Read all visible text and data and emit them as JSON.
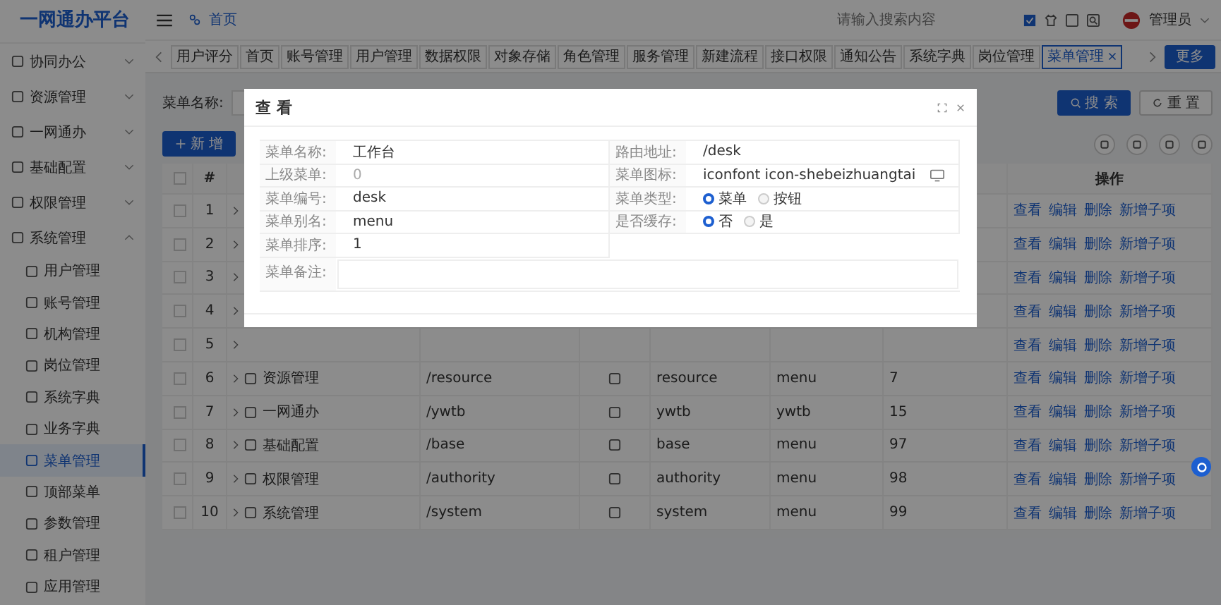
{
  "app": {
    "title": "一网通办平台"
  },
  "header": {
    "breadcrumb": "首页",
    "search": {
      "placeholder": "请输入搜索内容"
    },
    "user": "管理员"
  },
  "sidebar": {
    "items": [
      {
        "label": "协同办公",
        "expanded": false
      },
      {
        "label": "资源管理",
        "expanded": false
      },
      {
        "label": "一网通办",
        "expanded": false
      },
      {
        "label": "基础配置",
        "expanded": false
      },
      {
        "label": "权限管理",
        "expanded": false
      },
      {
        "label": "系统管理",
        "expanded": true,
        "children": [
          {
            "label": "用户管理",
            "selected": false
          },
          {
            "label": "账号管理",
            "selected": false
          },
          {
            "label": "机构管理",
            "selected": false
          },
          {
            "label": "岗位管理",
            "selected": false
          },
          {
            "label": "系统字典",
            "selected": false
          },
          {
            "label": "业务字典",
            "selected": false
          },
          {
            "label": "菜单管理",
            "selected": true
          },
          {
            "label": "顶部菜单",
            "selected": false
          },
          {
            "label": "参数管理",
            "selected": false
          },
          {
            "label": "租户管理",
            "selected": false
          },
          {
            "label": "应用管理",
            "selected": false
          }
        ]
      }
    ]
  },
  "tabs": [
    {
      "label": "用户评分",
      "selected": false,
      "closable": false
    },
    {
      "label": "首页",
      "selected": false,
      "closable": false
    },
    {
      "label": "账号管理",
      "selected": false,
      "closable": false
    },
    {
      "label": "用户管理",
      "selected": false,
      "closable": false
    },
    {
      "label": "数据权限",
      "selected": false,
      "closable": false
    },
    {
      "label": "对象存储",
      "selected": false,
      "closable": false
    },
    {
      "label": "角色管理",
      "selected": false,
      "closable": false
    },
    {
      "label": "服务管理",
      "selected": false,
      "closable": false
    },
    {
      "label": "新建流程",
      "selected": false,
      "closable": false
    },
    {
      "label": "接口权限",
      "selected": false,
      "closable": false
    },
    {
      "label": "通知公告",
      "selected": false,
      "closable": false
    },
    {
      "label": "系统字典",
      "selected": false,
      "closable": false
    },
    {
      "label": "岗位管理",
      "selected": false,
      "closable": false
    },
    {
      "label": "菜单管理",
      "selected": true,
      "closable": true
    }
  ],
  "more_button": "更多",
  "search_form": {
    "label": "菜单名称:",
    "search_button": "搜 索",
    "reset_button": "重 置"
  },
  "toolbar": {
    "add_button": "新 增"
  },
  "table": {
    "columns": [
      "#",
      "操作"
    ],
    "all_checked": false,
    "rows": [
      {
        "checked": false,
        "index": "1",
        "actions": [
          "查看",
          "编辑",
          "删除",
          "新增子项"
        ]
      },
      {
        "checked": false,
        "index": "2",
        "actions": [
          "查看",
          "编辑",
          "删除",
          "新增子项"
        ]
      },
      {
        "checked": false,
        "index": "3",
        "actions": [
          "查看",
          "编辑",
          "删除",
          "新增子项"
        ]
      },
      {
        "checked": false,
        "index": "4",
        "actions": [
          "查看",
          "编辑",
          "删除",
          "新增子项"
        ]
      },
      {
        "checked": false,
        "index": "5",
        "actions": [
          "查看",
          "编辑",
          "删除",
          "新增子项"
        ]
      },
      {
        "checked": false,
        "index": "6",
        "name": "资源管理",
        "path": "/resource",
        "code": "resource",
        "alias": "menu",
        "sort": "7",
        "actions": [
          "查看",
          "编辑",
          "删除",
          "新增子项"
        ]
      },
      {
        "checked": false,
        "index": "7",
        "name": "一网通办",
        "path": "/ywtb",
        "code": "ywtb",
        "alias": "ywtb",
        "sort": "15",
        "actions": [
          "查看",
          "编辑",
          "删除",
          "新增子项"
        ]
      },
      {
        "checked": false,
        "index": "8",
        "name": "基础配置",
        "path": "/base",
        "code": "base",
        "alias": "menu",
        "sort": "97",
        "actions": [
          "查看",
          "编辑",
          "删除",
          "新增子项"
        ]
      },
      {
        "checked": false,
        "index": "9",
        "name": "权限管理",
        "path": "/authority",
        "code": "authority",
        "alias": "menu",
        "sort": "98",
        "actions": [
          "查看",
          "编辑",
          "删除",
          "新增子项"
        ]
      },
      {
        "checked": false,
        "index": "10",
        "name": "系统管理",
        "path": "/system",
        "code": "system",
        "alias": "menu",
        "sort": "99",
        "actions": [
          "查看",
          "编辑",
          "删除",
          "新增子项"
        ]
      }
    ]
  },
  "dialog": {
    "title": "查 看",
    "left_fields": [
      {
        "label": "菜单名称:",
        "value": "工作台",
        "muted": false
      },
      {
        "label": "上级菜单:",
        "value": "0",
        "muted": true
      },
      {
        "label": "菜单编号:",
        "value": "desk",
        "muted": false
      },
      {
        "label": "菜单别名:",
        "value": "menu",
        "muted": false
      },
      {
        "label": "菜单排序:",
        "value": "1",
        "muted": false
      }
    ],
    "right_fields": [
      {
        "label": "路由地址:",
        "kind": "text",
        "value": "/desk"
      },
      {
        "label": "菜单图标:",
        "kind": "icon",
        "value": "iconfont icon-shebeizhuangtai"
      },
      {
        "label": "菜单类型:",
        "kind": "radio",
        "options": [
          {
            "label": "菜单",
            "selected": true
          },
          {
            "label": "按钮",
            "selected": false
          }
        ]
      },
      {
        "label": "是否缓存:",
        "kind": "radio",
        "options": [
          {
            "label": "否",
            "selected": true
          },
          {
            "label": "是",
            "selected": false
          }
        ]
      }
    ],
    "remark": {
      "label": "菜单备注:"
    }
  }
}
